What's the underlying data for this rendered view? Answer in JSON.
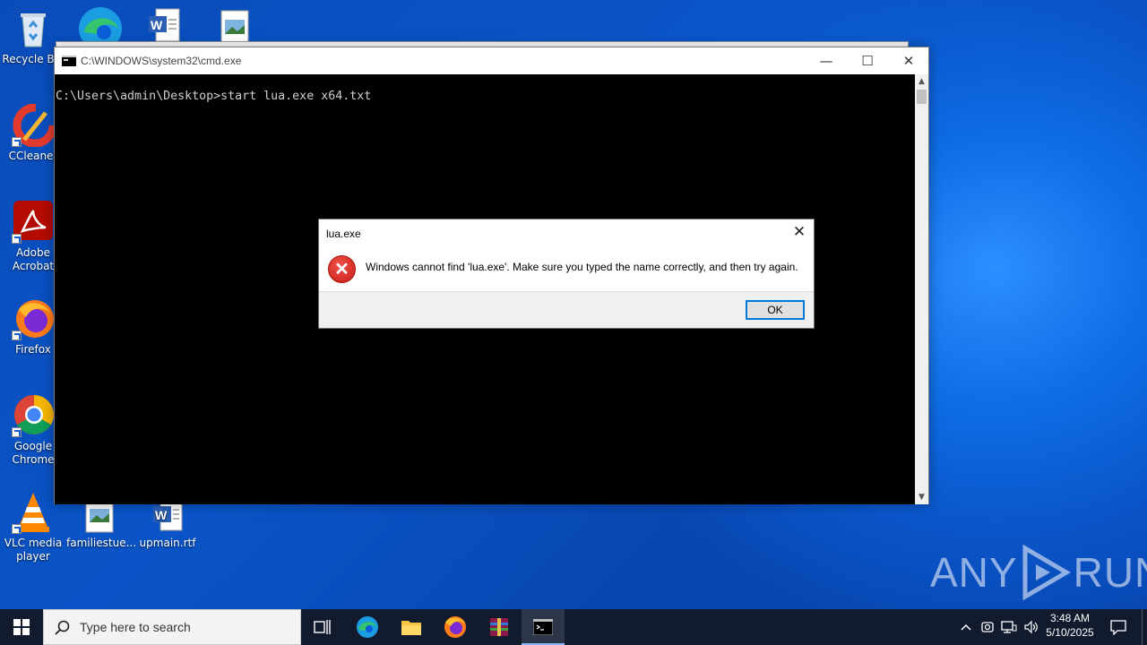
{
  "desktop": {
    "icons": [
      {
        "label": "Recycle Bin",
        "icon": "recycle-bin-icon"
      },
      {
        "label": "CCleaner",
        "icon": "ccleaner-icon"
      },
      {
        "label": "Adobe Acrobat",
        "icon": "adobe-acrobat-icon"
      },
      {
        "label": "Firefox",
        "icon": "firefox-icon"
      },
      {
        "label": "Google Chrome",
        "icon": "chrome-icon"
      },
      {
        "label": "VLC media player",
        "icon": "vlc-icon"
      },
      {
        "label": "familiestue...",
        "icon": "image-file-icon"
      },
      {
        "label": "upmain.rtf",
        "icon": "word-doc-icon"
      }
    ]
  },
  "cmd_window": {
    "title": "C:\\WINDOWS\\system32\\cmd.exe",
    "minimize_label": "—",
    "maximize_label": "☐",
    "close_label": "✕",
    "console_text": "C:\\Users\\admin\\Desktop>start lua.exe x64.txt"
  },
  "dialog": {
    "title": "lua.exe",
    "close_label": "✕",
    "message": "Windows cannot find 'lua.exe'. Make sure you typed the name correctly, and then try again.",
    "ok_label": "OK"
  },
  "taskbar": {
    "search_placeholder": "Type here to search",
    "time": "3:48 AM",
    "date": "5/10/2025"
  },
  "watermark": {
    "left": "ANY",
    "right": "RUN"
  }
}
